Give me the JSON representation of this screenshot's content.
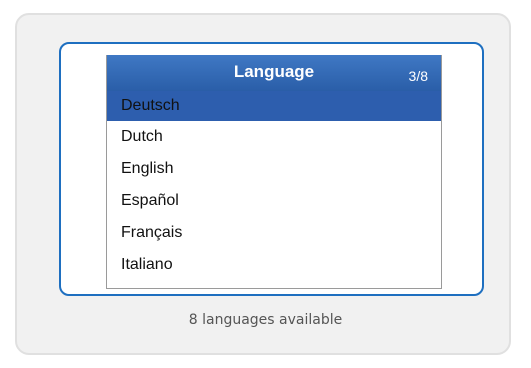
{
  "menu": {
    "title": "Language",
    "counter": "3/8",
    "items": [
      {
        "label": "Deutsch"
      },
      {
        "label": "Dutch"
      },
      {
        "label": "English"
      },
      {
        "label": "Español"
      },
      {
        "label": "Français"
      },
      {
        "label": "Italiano"
      }
    ],
    "selected_index": 0
  },
  "caption": "8 languages available",
  "colors": {
    "accent_border": "#1e6fc0",
    "titlebar": "#3a70bc",
    "selection": "#2d5eae"
  }
}
